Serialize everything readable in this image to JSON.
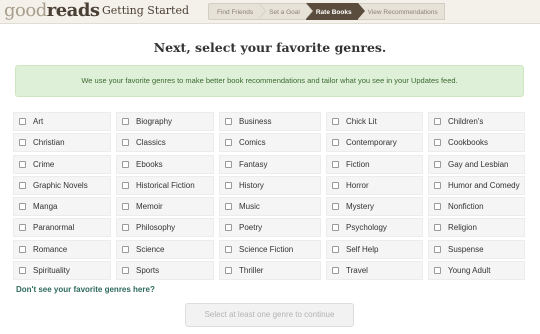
{
  "header": {
    "logo_light": "good",
    "logo_bold": "reads",
    "page_label": "Getting Started",
    "steps": [
      {
        "label": "Find Friends",
        "active": false
      },
      {
        "label": "Set a Goal",
        "active": false
      },
      {
        "label": "Rate Books",
        "active": true
      },
      {
        "label": "View Recommendations",
        "active": false
      }
    ]
  },
  "main": {
    "title": "Next, select your favorite genres.",
    "info": "We use your favorite genres to make better book recommendations and tailor what you see in your Updates feed.",
    "genres": [
      "Art",
      "Biography",
      "Business",
      "Chick Lit",
      "Children's",
      "Christian",
      "Classics",
      "Comics",
      "Contemporary",
      "Cookbooks",
      "Crime",
      "Ebooks",
      "Fantasy",
      "Fiction",
      "Gay and Lesbian",
      "Graphic Novels",
      "Historical Fiction",
      "History",
      "Horror",
      "Humor and Comedy",
      "Manga",
      "Memoir",
      "Music",
      "Mystery",
      "Nonfiction",
      "Paranormal",
      "Philosophy",
      "Poetry",
      "Psychology",
      "Religion",
      "Romance",
      "Science",
      "Science Fiction",
      "Self Help",
      "Suspense",
      "Spirituality",
      "Sports",
      "Thriller",
      "Travel",
      "Young Adult"
    ],
    "more_link": "Don't see your favorite genres here?",
    "continue_label": "Select at least one genre to continue"
  },
  "colors": {
    "header_bg": "#f4f1ea",
    "active_step": "#5b4d3d",
    "info_bg": "#dff0d8",
    "link": "#2e6a5c"
  }
}
